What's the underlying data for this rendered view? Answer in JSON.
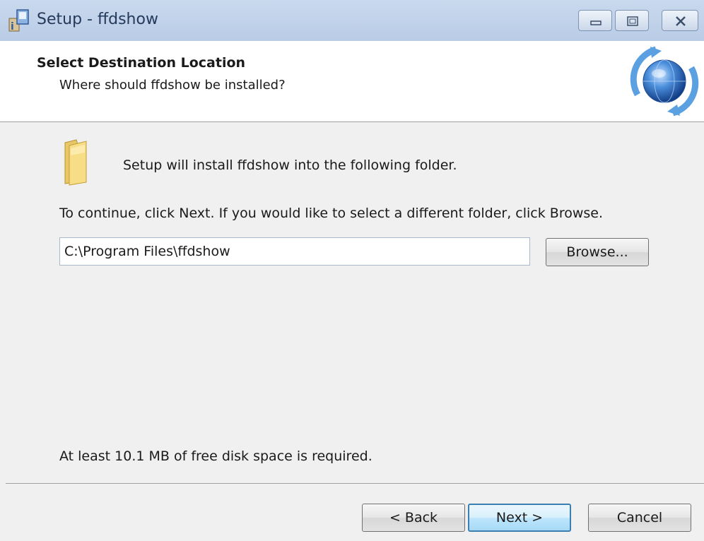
{
  "window": {
    "title": "Setup - ffdshow"
  },
  "header": {
    "title": "Select Destination Location",
    "subtitle": "Where should ffdshow be installed?"
  },
  "body": {
    "intro": "Setup will install ffdshow into the following folder.",
    "instructions": "To continue, click Next. If you would like to select a different folder, click Browse.",
    "path_value": "C:\\Program Files\\ffdshow",
    "browse_label": "Browse...",
    "disk_space": "At least 10.1 MB of free disk space is required."
  },
  "footer": {
    "back_label": "< Back",
    "next_label": "Next >",
    "cancel_label": "Cancel"
  },
  "icons": {
    "app": "installer-icon",
    "header_logo": "globe-refresh-icon",
    "folder": "folder-icon",
    "minimize": "minimize-icon",
    "maximize": "maximize-icon",
    "close": "close-icon"
  }
}
